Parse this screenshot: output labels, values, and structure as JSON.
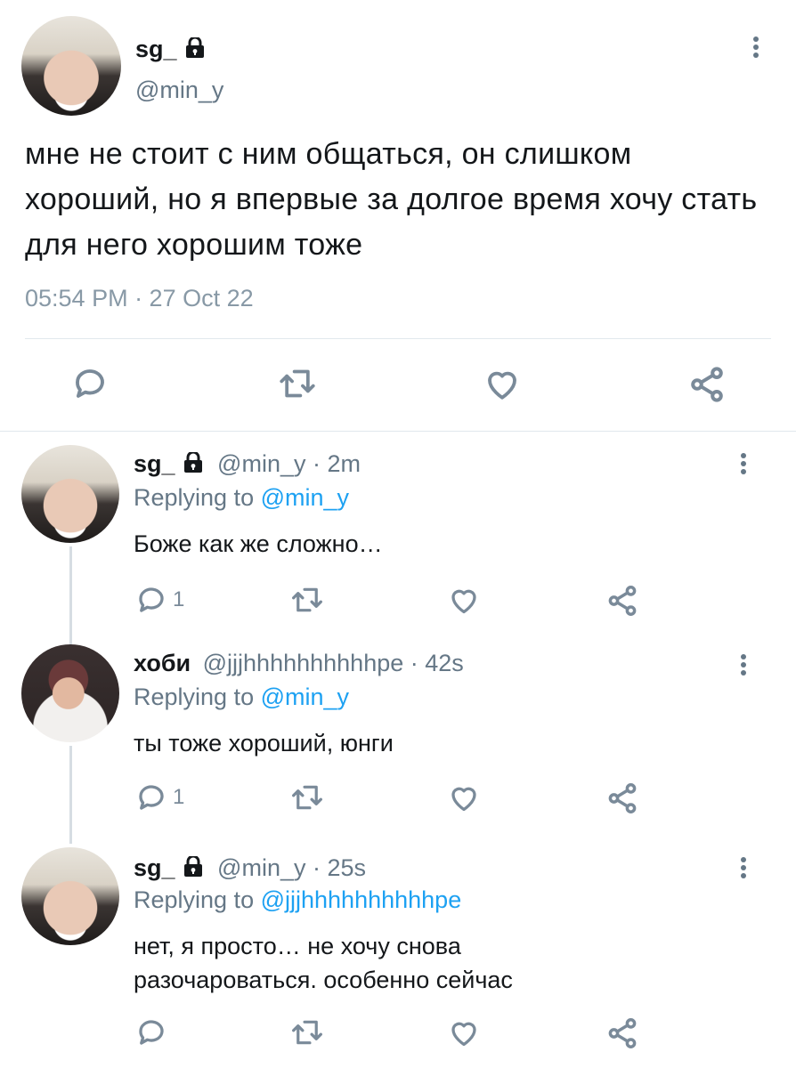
{
  "main_tweet": {
    "name": "sg_",
    "handle": "@min_y",
    "text": "мне не стоит с ним общаться, он слишком хороший, но я впервые за долгое время хочу стать для него хорошим тоже",
    "timestamp": "05:54 PM · 27 Oct 22",
    "icons": [
      "reply-icon",
      "retweet-icon",
      "like-icon",
      "share-icon"
    ]
  },
  "replies": [
    {
      "name": "sg_",
      "handle": "@min_y",
      "time": "· 2m",
      "replying_label": "Replying to",
      "replying_to": "@min_y",
      "text": "Боже как же сложно…",
      "reply_count": "1",
      "locked": true
    },
    {
      "name": "хоби",
      "handle": "@jjjhhhhhhhhhhpe",
      "time": "· 42s",
      "replying_label": "Replying to",
      "replying_to": "@min_y",
      "text": "ты тоже хороший, юнги",
      "reply_count": "1",
      "locked": false
    },
    {
      "name": "sg_",
      "handle": "@min_y",
      "time": "· 25s",
      "replying_label": "Replying to",
      "replying_to": "@jjjhhhhhhhhhhpe",
      "text": "нет, я просто… не хочу снова разочароваться. особенно сейчас",
      "reply_count": "",
      "locked": true
    }
  ],
  "colors": {
    "text": "#14171a",
    "muted": "#657786",
    "link": "#1da1f2",
    "divider": "#e1e8ed"
  }
}
